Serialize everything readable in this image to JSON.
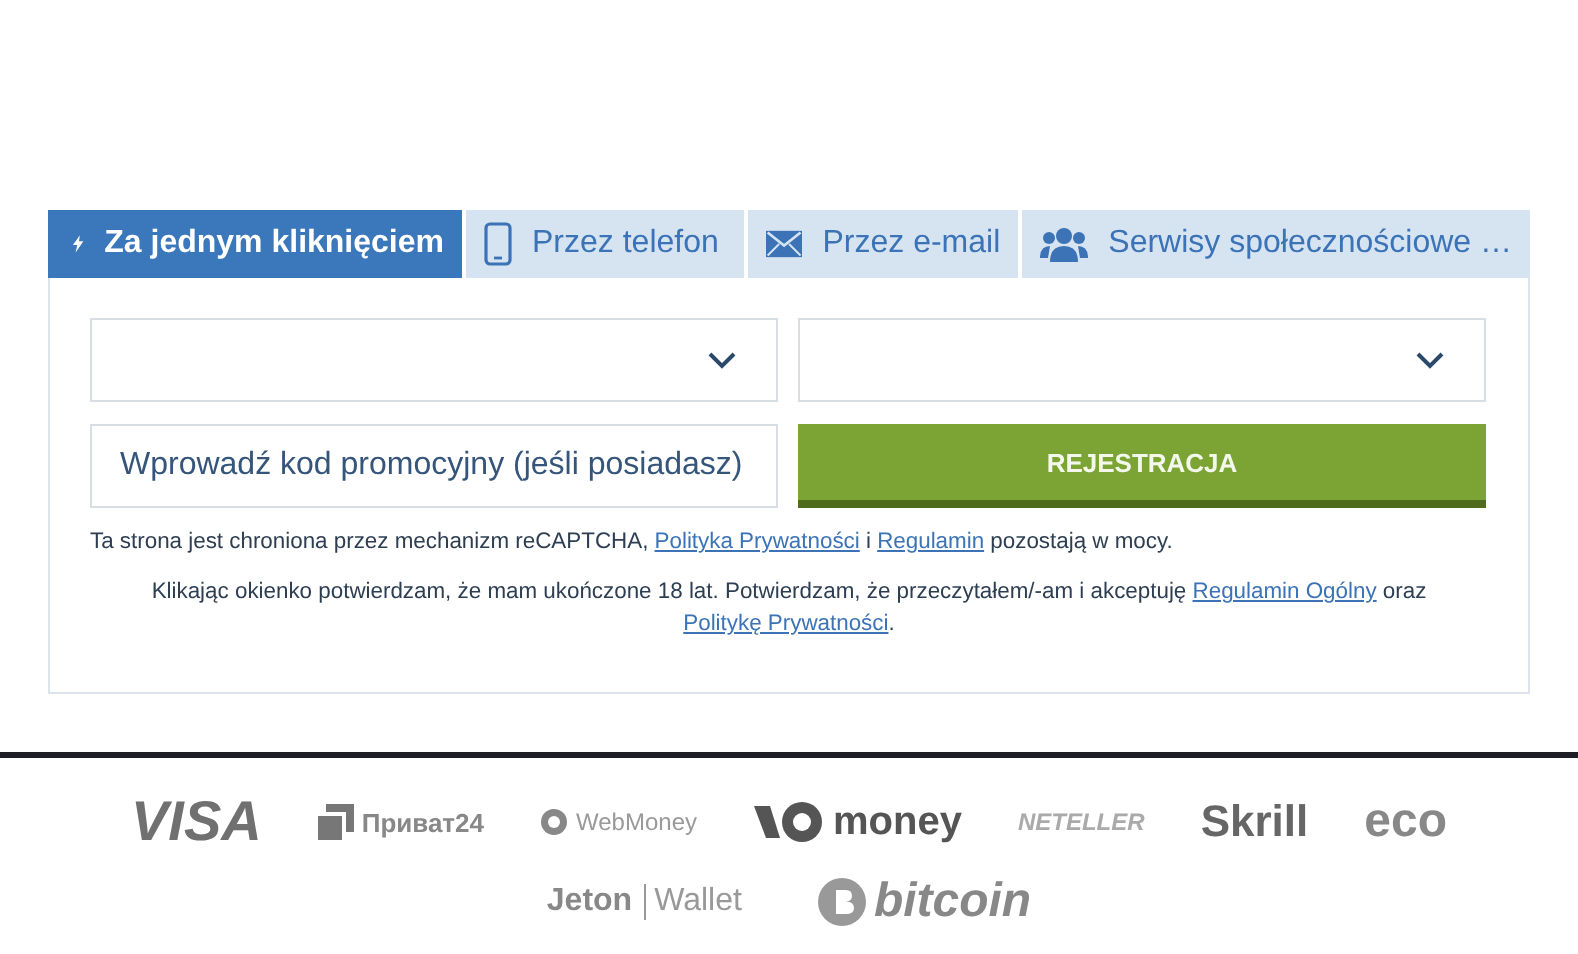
{
  "tabs": [
    {
      "label": "Za jednym kliknięciem",
      "kind": "bolt",
      "selected": true
    },
    {
      "label": "Przez telefon",
      "kind": "phone",
      "selected": false
    },
    {
      "label": "Przez e-mail",
      "kind": "mail",
      "selected": false
    },
    {
      "label": "Serwisy społecznościowe …",
      "kind": "people",
      "selected": false
    }
  ],
  "selects": [
    {
      "kind": "select"
    },
    {
      "kind": "select"
    }
  ],
  "promo": {
    "placeholder": "Wprowadź kod promocyjny (jeśli posiadasz)"
  },
  "register_button": "REJESTRACJA",
  "notice": [
    {
      "kind": "text",
      "text": "Ta strona jest chroniona przez mechanizm reCAPTCHA, "
    },
    {
      "kind": "link",
      "text": "Polityka Prywatności"
    },
    {
      "kind": "text",
      "text": " i "
    },
    {
      "kind": "link",
      "text": "Regulamin"
    },
    {
      "kind": "text",
      "text": " pozostają w mocy."
    }
  ],
  "consent": [
    {
      "kind": "text",
      "text": "Klikając okienko potwierdzam, że mam ukończone 18 lat. Potwierdzam, że przeczytałem/-am i akceptuję "
    },
    {
      "kind": "link",
      "text": "Regulamin Ogólny"
    },
    {
      "kind": "text",
      "text": " oraz "
    },
    {
      "kind": "link",
      "text": "Politykę Prywatności"
    },
    {
      "kind": "text",
      "text": "."
    }
  ],
  "payment_logos": [
    [
      {
        "kind": "visa",
        "text": "VISA"
      },
      {
        "kind": "privat",
        "text": "Приват24"
      },
      {
        "kind": "webmoney",
        "text": "WebMoney"
      },
      {
        "kind": "yoomoney",
        "text": "money"
      },
      {
        "kind": "neteller",
        "text": "NETELLER"
      },
      {
        "kind": "skrill",
        "text": "Skrill"
      },
      {
        "kind": "eco",
        "text": "eco"
      }
    ],
    [
      {
        "kind": "jeton",
        "text": "Jeton"
      },
      {
        "kind": "jeton2",
        "text": "Wallet"
      },
      {
        "kind": "bitcoin",
        "text": "bitcoin"
      }
    ]
  ]
}
